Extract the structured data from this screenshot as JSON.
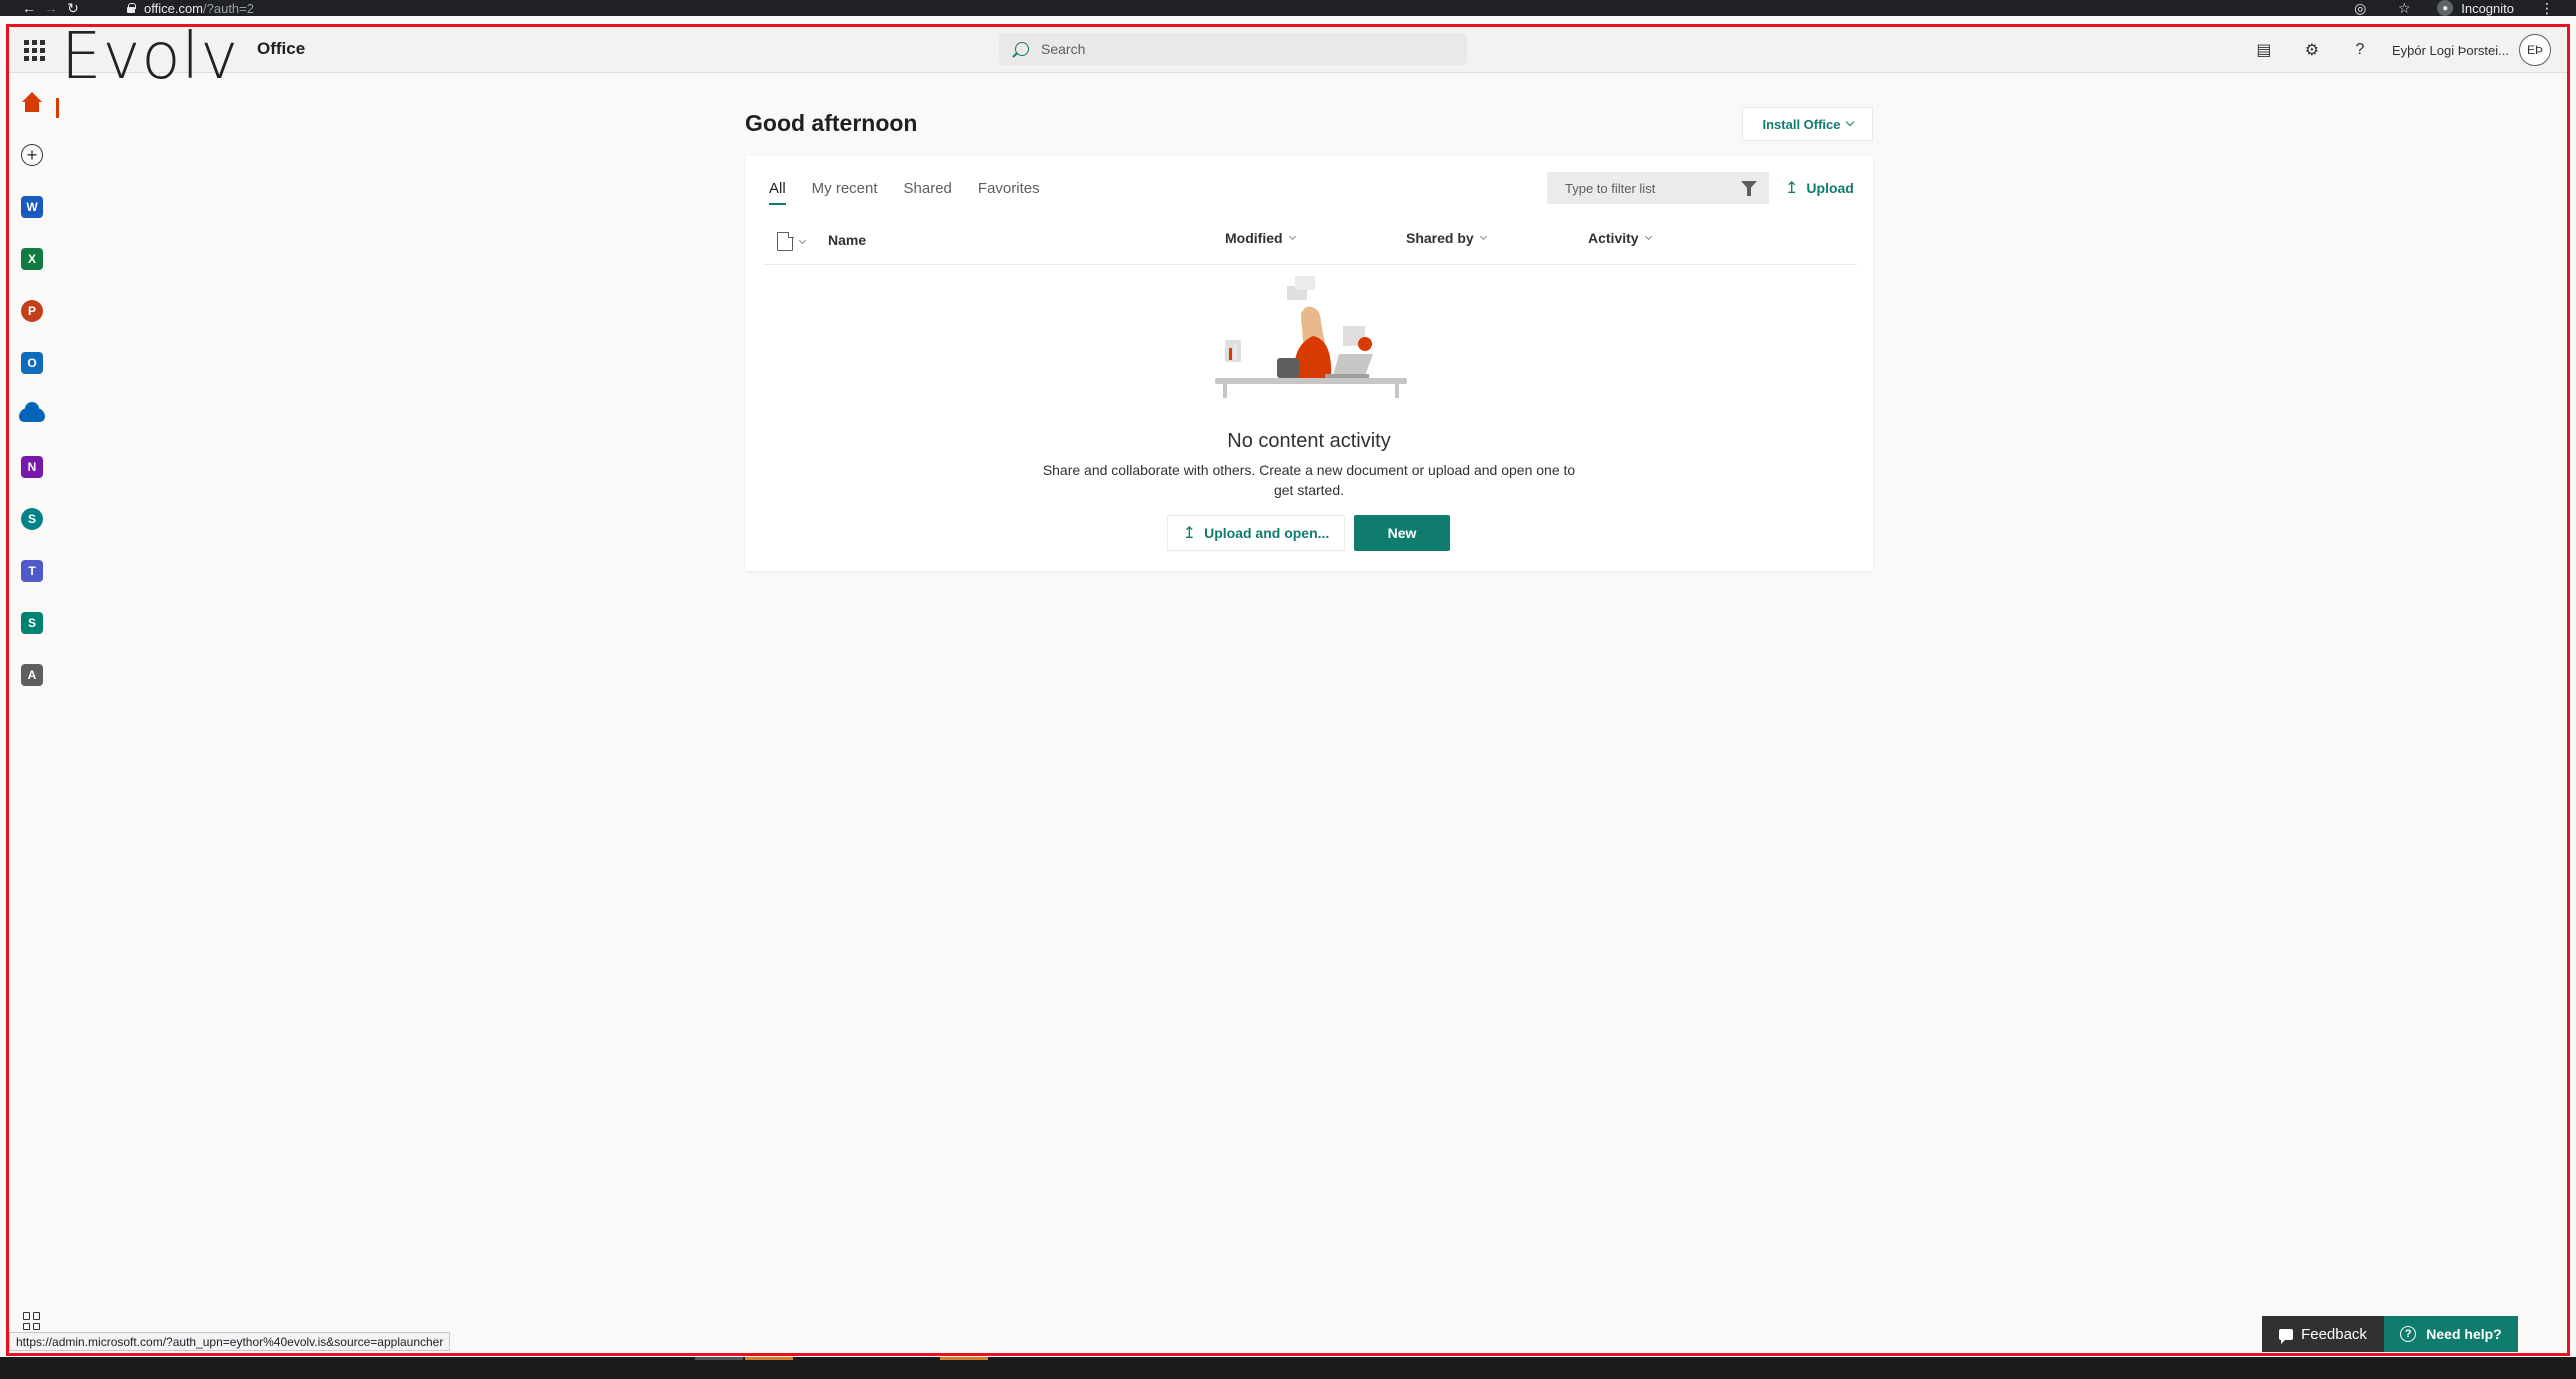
{
  "browser": {
    "url_host": "office.com",
    "url_path": "/?auth=2",
    "incognito_label": "Incognito"
  },
  "header": {
    "org_logo": "Evolv",
    "app_name": "Office",
    "search_placeholder": "Search",
    "user_name": "Eyþór Logi Þorstei...",
    "user_initials": "EÞ"
  },
  "rail": {
    "apps": [
      {
        "name": "home",
        "glyph": ""
      },
      {
        "name": "create",
        "glyph": "+"
      },
      {
        "name": "word",
        "glyph": "W",
        "color": "#185abd"
      },
      {
        "name": "excel",
        "glyph": "X",
        "color": "#107c41"
      },
      {
        "name": "powerpoint",
        "glyph": "P",
        "color": "#c43e1c"
      },
      {
        "name": "outlook",
        "glyph": "O",
        "color": "#0f6cbd"
      },
      {
        "name": "onedrive",
        "glyph": ""
      },
      {
        "name": "onenote",
        "glyph": "N",
        "color": "#7719aa"
      },
      {
        "name": "sharepoint",
        "glyph": "S",
        "color": "#038387"
      },
      {
        "name": "teams",
        "glyph": "T",
        "color": "#5059c9"
      },
      {
        "name": "sway",
        "glyph": "S",
        "color": "#008272"
      },
      {
        "name": "admin",
        "glyph": "A",
        "color": "#605e5c"
      }
    ]
  },
  "main": {
    "greeting": "Good afternoon",
    "install_office_label": "Install Office",
    "tabs": [
      {
        "label": "All",
        "active": true
      },
      {
        "label": "My recent",
        "active": false
      },
      {
        "label": "Shared",
        "active": false
      },
      {
        "label": "Favorites",
        "active": false
      }
    ],
    "filter_placeholder": "Type to filter list",
    "upload_label": "Upload",
    "columns": {
      "name": "Name",
      "modified": "Modified",
      "shared_by": "Shared by",
      "activity": "Activity"
    },
    "empty_title": "No content activity",
    "empty_description": "Share and collaborate with others. Create a new document or upload and open one to get started.",
    "upload_open_label": "Upload and open...",
    "new_label": "New"
  },
  "footer": {
    "status_url": "https://admin.microsoft.com/?auth_upn=eythor%40evolv.is&source=applauncher",
    "feedback_label": "Feedback",
    "help_label": "Need help?"
  },
  "colors": {
    "accent": "#107c6d",
    "office_orange": "#d83b01",
    "frame": "#e81123"
  }
}
